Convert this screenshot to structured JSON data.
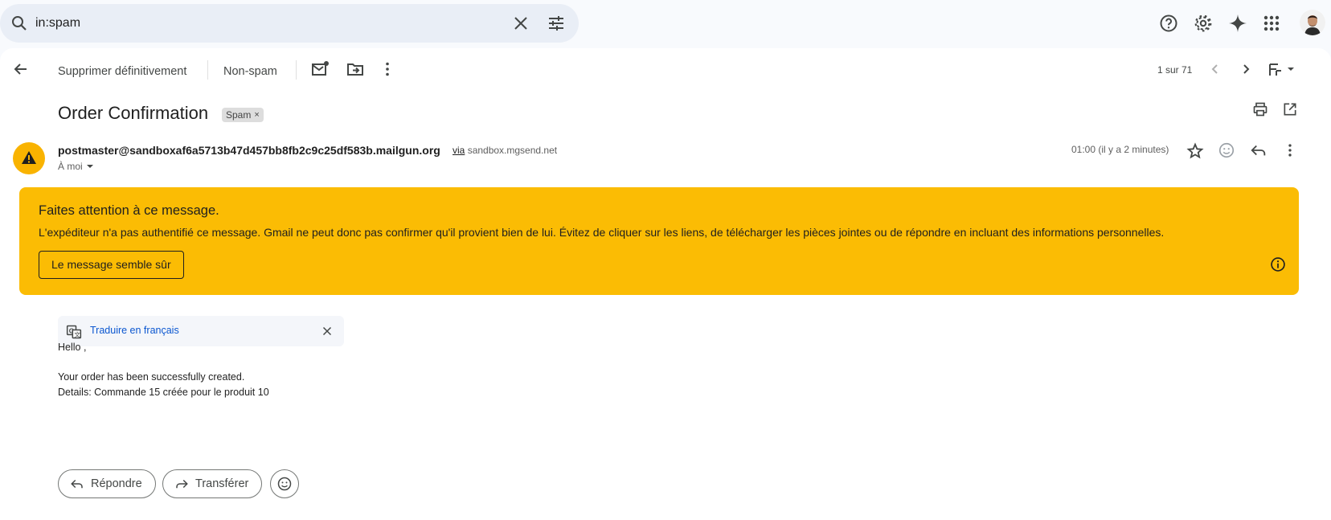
{
  "search": {
    "value": "in:spam"
  },
  "toolbar": {
    "delete_forever": "Supprimer définitivement",
    "not_spam": "Non-spam",
    "pager": "1 sur 71"
  },
  "message": {
    "subject": "Order Confirmation",
    "label": "Spam",
    "label_remove": "×",
    "sender": "postmaster@sandboxaf6a5713b47d457bb8fb2c9c25df583b.mailgun.org",
    "via_word": "via",
    "via_domain": "sandbox.mgsend.net",
    "to": "À moi",
    "date": "01:00 (il y a 2 minutes)"
  },
  "warning": {
    "title": "Faites attention à ce message.",
    "body": "L'expéditeur n'a pas authentifié ce message. Gmail ne peut donc pas confirmer qu'il provient bien de lui. Évitez de cliquer sur les liens, de télécharger les pièces jointes ou de répondre en incluant des informations personnelles.",
    "button": "Le message semble sûr"
  },
  "translate": {
    "link": "Traduire en français"
  },
  "content": {
    "greeting": "Hello ,",
    "line1": "Your order has been successfully created.",
    "line2": "Details: Commande 15 créée pour le produit 10"
  },
  "actions": {
    "reply": "Répondre",
    "forward": "Transférer"
  },
  "colors": {
    "warning_bg": "#fbbc04",
    "link": "#0b57d0",
    "page_bg": "#f8fafd"
  }
}
